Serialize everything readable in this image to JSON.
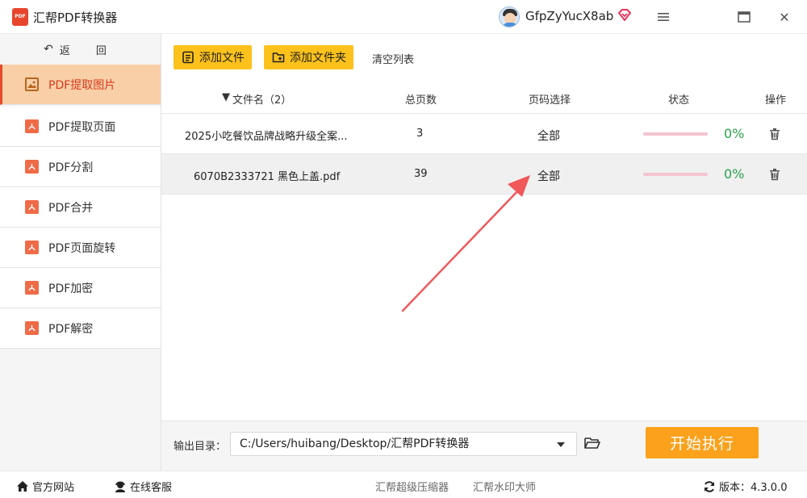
{
  "titlebar": {
    "app_icon_text": "PDF",
    "app_title": "汇帮PDF转换器",
    "username": "GfpZyYucX8ab",
    "close_glyph": "✕"
  },
  "sidebar": {
    "back_label": "返 回",
    "items": [
      {
        "label": "PDF提取图片",
        "icon": "image-icon",
        "active": true
      },
      {
        "label": "PDF提取页面",
        "icon": "pdf-icon"
      },
      {
        "label": "PDF分割",
        "icon": "pdf-icon"
      },
      {
        "label": "PDF合并",
        "icon": "pdf-icon"
      },
      {
        "label": "PDF页面旋转",
        "icon": "pdf-icon"
      },
      {
        "label": "PDF加密",
        "icon": "pdf-icon"
      },
      {
        "label": "PDF解密",
        "icon": "pdf-icon"
      }
    ]
  },
  "toolbar": {
    "add_file": "添加文件",
    "add_folder": "添加文件夹",
    "clear_list": "清空列表"
  },
  "table": {
    "headers": {
      "filename": "文件名（2）",
      "pages": "总页数",
      "page_select": "页码选择",
      "status": "状态",
      "action": "操作"
    },
    "rows": [
      {
        "filename": "2025小吃餐饮品牌战略升级全案...",
        "pages": "3",
        "page_select": "全部",
        "progress": 0,
        "percent": "0%"
      },
      {
        "filename": "6070B2333721 黑色上盖.pdf",
        "pages": "39",
        "page_select": "全部",
        "progress": 0,
        "percent": "0%",
        "selected": true
      }
    ]
  },
  "output": {
    "label": "输出目录：",
    "path": "C:/Users/huibang/Desktop/汇帮PDF转换器",
    "start_label": "开始执行"
  },
  "footer": {
    "website": "官方网站",
    "service": "在线客服",
    "link1": "汇帮超级压缩器",
    "link2": "汇帮水印大师",
    "version": "版本：4.3.0.0"
  },
  "colors": {
    "accent_yellow": "#fcc21b",
    "start_orange": "#fba11b",
    "active_bg": "#f8cfa7",
    "active_text": "#d93a1b",
    "success_green": "#2aa14a",
    "annotation_arrow": "#f0585a"
  }
}
